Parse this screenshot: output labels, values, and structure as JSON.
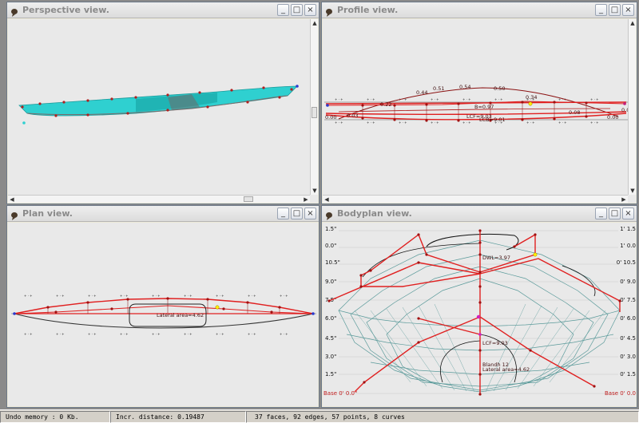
{
  "windows": {
    "perspective": {
      "title": "Perspective view."
    },
    "profile": {
      "title": "Profile view.",
      "labels": [
        "0.44",
        "0.51",
        "0.54",
        "0.50",
        "0.34",
        "0.22",
        "0.08",
        "0.03",
        "0.00",
        "0.00",
        "0.00",
        "B=0.97",
        "LCF=9.03",
        "LCB=9.01"
      ]
    },
    "plan": {
      "title": "Plan view.",
      "labels": [
        "Lateral area=4.62"
      ]
    },
    "bodyplan": {
      "title": "Bodyplan view.",
      "left_scale": [
        "1.5\"",
        "0.0\"",
        "10.5\"",
        "9.0\"",
        "7.5\"",
        "6.0\"",
        "4.5\"",
        "3.0\"",
        "1.5\"",
        "Base 0' 0.0\""
      ],
      "right_scale": [
        "1' 1.5",
        "1' 0.0",
        "0' 10.5",
        "0' 9.0",
        "0' 7.5",
        "0' 6.0",
        "0' 4.5",
        "0' 3.0",
        "0' 1.5",
        "Base 0' 0.0"
      ],
      "labels": [
        "LCF=9.03",
        "Blandh 12",
        "Lateral area=4.62",
        "DWL=3.97"
      ]
    }
  },
  "window_buttons": {
    "minimize": "_",
    "maximize": "□",
    "close": "×"
  },
  "icons": {
    "title_icon": "balloon-icon",
    "minimize": "minimize-icon",
    "maximize": "maximize-icon",
    "close": "close-icon"
  },
  "colors": {
    "hull_cyan": "#2fd0d0",
    "curve_red": "#e02020",
    "point_red": "#a01010",
    "station_teal": "#5a9a9a",
    "control_yellow": "#ffee00"
  },
  "statusbar": {
    "undo": "Undo memory : 0 Kb.",
    "incr": "Incr. distance: 0.19487",
    "info": "37 faces, 92 edges, 57 points, 8 curves"
  }
}
